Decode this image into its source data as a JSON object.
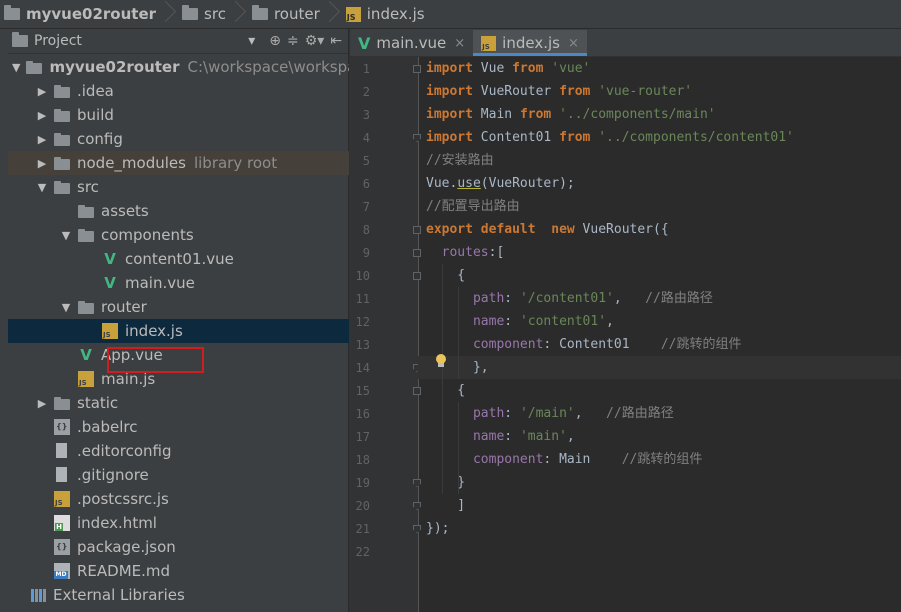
{
  "breadcrumb": {
    "project": "myvue02router",
    "items": [
      "src",
      "router",
      "index.js"
    ]
  },
  "project_panel": {
    "title": "Project",
    "tools": [
      "⊕",
      "≑",
      "⚙▾",
      "⇤"
    ]
  },
  "tree": [
    {
      "label": "myvue02router",
      "sub": "C:\\workspace\\workspa",
      "icon": "folder",
      "expanded": true
    },
    {
      "label": ".idea",
      "icon": "folder",
      "expanded": false
    },
    {
      "label": "build",
      "icon": "folder",
      "expanded": false
    },
    {
      "label": "config",
      "icon": "folder",
      "expanded": false
    },
    {
      "label": "node_modules",
      "sub": "library root",
      "icon": "folder",
      "expanded": false
    },
    {
      "label": "src",
      "icon": "folder",
      "expanded": true
    },
    {
      "label": "assets",
      "icon": "folder"
    },
    {
      "label": "components",
      "icon": "folder",
      "expanded": true
    },
    {
      "label": "content01.vue",
      "icon": "vue"
    },
    {
      "label": "main.vue",
      "icon": "vue"
    },
    {
      "label": "router",
      "icon": "folder",
      "expanded": true
    },
    {
      "label": "index.js",
      "icon": "js",
      "selected": true
    },
    {
      "label": "App.vue",
      "icon": "vue"
    },
    {
      "label": "main.js",
      "icon": "js"
    },
    {
      "label": "static",
      "icon": "folder",
      "expanded": false
    },
    {
      "label": ".babelrc",
      "icon": "cfg"
    },
    {
      "label": ".editorconfig",
      "icon": "txt"
    },
    {
      "label": ".gitignore",
      "icon": "txt"
    },
    {
      "label": ".postcssrc.js",
      "icon": "js"
    },
    {
      "label": "index.html",
      "icon": "html"
    },
    {
      "label": "package.json",
      "icon": "cfg"
    },
    {
      "label": "README.md",
      "icon": "md"
    },
    {
      "label": "External Libraries",
      "icon": "libs"
    }
  ],
  "tabs": [
    {
      "label": "main.vue",
      "icon": "vue",
      "active": false
    },
    {
      "label": "index.js",
      "icon": "js",
      "active": true
    }
  ],
  "code": [
    "import Vue from 'vue'",
    "import VueRouter from 'vue-router'",
    "import Main from '../components/main'",
    "import Content01 from '../components/content01'",
    "//安装路由",
    "Vue.use(VueRouter);",
    "//配置导出路由",
    "export default  new VueRouter({",
    "  routes:[",
    "    {",
    "      path: '/content01',   //路由路径",
    "      name: 'content01',",
    "      component: Content01    //跳转的组件",
    "      },",
    "    {",
    "      path: '/main',   //路由路径",
    "      name: 'main',",
    "      component: Main    //跳转的组件",
    "    }",
    "    ]",
    "});",
    ""
  ]
}
